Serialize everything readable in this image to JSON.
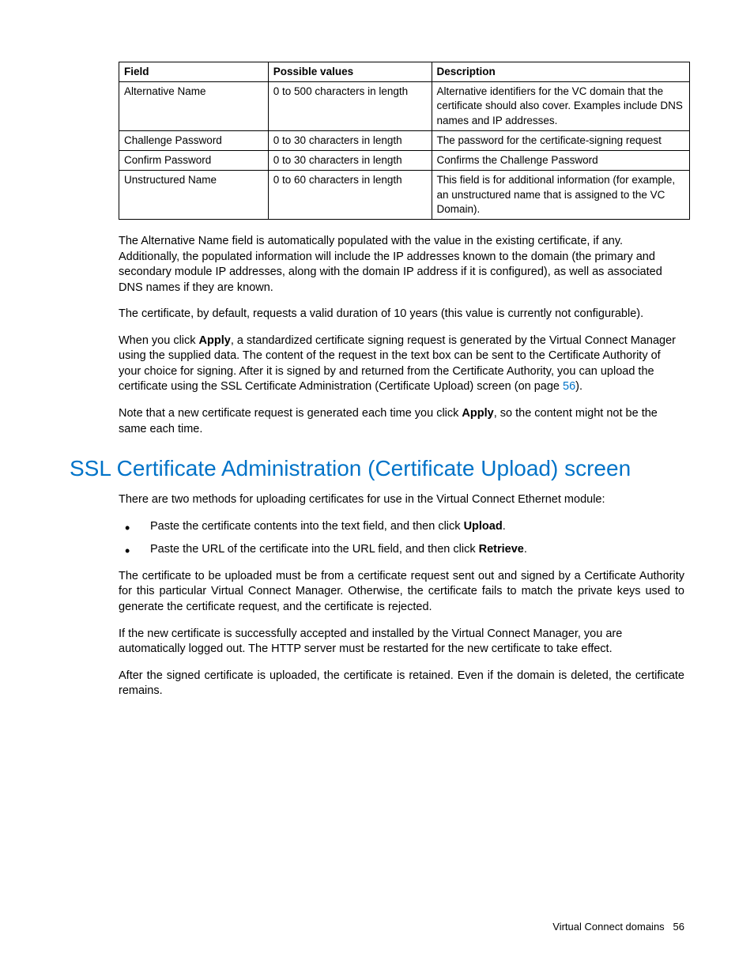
{
  "table": {
    "headers": [
      "Field",
      "Possible values",
      "Description"
    ],
    "rows": [
      {
        "field": "Alternative Name",
        "pv": "0 to 500 characters in length",
        "desc": "Alternative identifiers for the VC domain that the certificate should also cover. Examples include DNS names and IP addresses."
      },
      {
        "field": "Challenge Password",
        "pv": "0 to 30 characters in length",
        "desc": "The password for the certificate-signing request"
      },
      {
        "field": "Confirm Password",
        "pv": "0 to 30 characters in length",
        "desc": "Confirms the Challenge Password"
      },
      {
        "field": "Unstructured Name",
        "pv": "0 to 60 characters in length",
        "desc": "This field is for additional information (for example, an unstructured name that is assigned to the VC Domain)."
      }
    ]
  },
  "p1": "The Alternative Name field is automatically populated with the value in the existing certificate, if any. Additionally, the populated information will include the IP addresses known to the domain (the primary and secondary module IP addresses, along with the domain IP address if it is configured), as well as associated DNS names if they are known.",
  "p2": "The certificate, by default, requests a valid duration of 10 years (this value is currently not configurable).",
  "p3_a": "When you click ",
  "p3_b": "Apply",
  "p3_c": ", a standardized certificate signing request is generated by the Virtual Connect Manager using the supplied data. The content of the request in the text box can be sent to the Certificate Authority of your choice for signing. After it is signed by and returned from the Certificate Authority, you can upload the certificate using the SSL Certificate Administration (Certificate Upload) screen (on page ",
  "p3_d": "56",
  "p3_e": ").",
  "p4_a": "Note that a new certificate request is generated each time you click ",
  "p4_b": "Apply",
  "p4_c": ", so the content might not be the same each time.",
  "heading": "SSL Certificate Administration (Certificate Upload) screen",
  "p5": "There are two methods for uploading certificates for use in the Virtual Connect Ethernet module:",
  "li1_a": "Paste the certificate contents into the text field, and then click ",
  "li1_b": "Upload",
  "li1_c": ".",
  "li2_a": "Paste the URL of the certificate into the URL field, and then click ",
  "li2_b": "Retrieve",
  "li2_c": ".",
  "p6": "The certificate to be uploaded must be from a certificate request sent out and signed by a Certificate Authority for this particular Virtual Connect Manager. Otherwise, the certificate fails to match the private keys used to generate the certificate request, and the certificate is rejected.",
  "p7": "If the new certificate is successfully accepted and installed by the Virtual Connect Manager, you are automatically logged out. The HTTP server must be restarted for the new certificate to take effect.",
  "p8": "After the signed certificate is uploaded, the certificate is retained. Even if the domain is deleted, the certificate remains.",
  "footer_a": "Virtual Connect domains",
  "footer_b": "56"
}
